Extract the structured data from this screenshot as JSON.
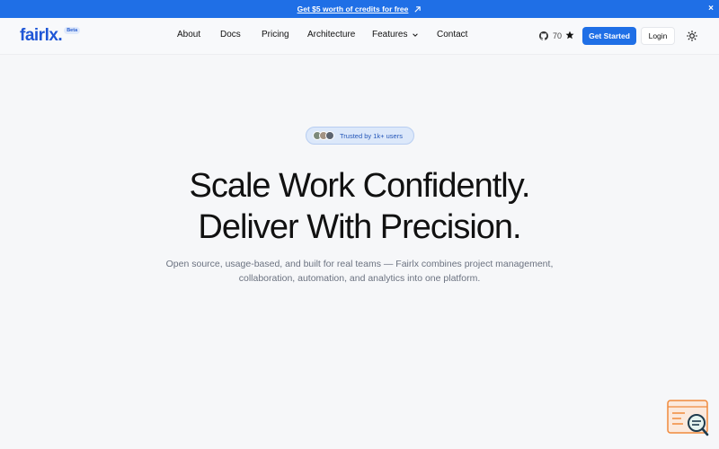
{
  "promo": {
    "text": "Get $5 worth of credits for free",
    "close": "×"
  },
  "brand": {
    "name": "fairlx.",
    "badge": "Beta"
  },
  "nav": {
    "links": [
      "About",
      "Docs",
      "Pricing",
      "Architecture",
      "Features",
      "Contact"
    ]
  },
  "header_right": {
    "star_count": "70",
    "get_started": "Get Started",
    "login": "Login"
  },
  "hero": {
    "trust": "Trusted by 1k+ users",
    "headline_line1": "Scale Work Confidently.",
    "headline_line2": "Deliver With Precision.",
    "subtext_line1": "Open source, usage-based, and built for real teams — Fairlx combines project management,",
    "subtext_line2": "collaboration, automation, and analytics into one platform."
  },
  "colors": {
    "accent": "#1f6fe6",
    "brand": "#1f56d6",
    "background": "#f6f7f9"
  },
  "icons": [
    "external-arrow-icon",
    "close-icon",
    "chevron-down-icon",
    "github-icon",
    "star-icon",
    "sun-icon",
    "chat-widget-icon"
  ]
}
